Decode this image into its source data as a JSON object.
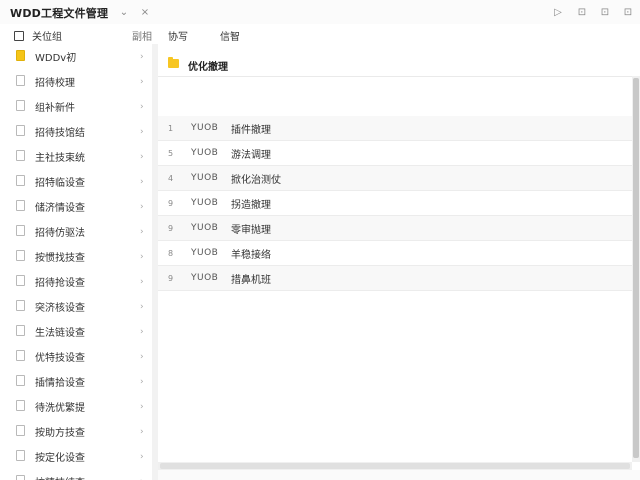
{
  "window": {
    "title": "WDD工程文件管理",
    "menu_chevron": "⌄",
    "close": "×",
    "controls": [
      "▷",
      "⊡",
      "⊡",
      "⊡"
    ]
  },
  "toolbar": {
    "left_label": "关位组",
    "left_right_label": "副相",
    "main_label_1": "协写",
    "main_label_2": "信智"
  },
  "sidebar": {
    "items": [
      {
        "label": "WDDv初"
      },
      {
        "label": "招待校理"
      },
      {
        "label": "组补新件"
      },
      {
        "label": "招待技馆结"
      },
      {
        "label": "主社技束统"
      },
      {
        "label": "招特临设查"
      },
      {
        "label": "储济情设查"
      },
      {
        "label": "招待仿驱法"
      },
      {
        "label": "按惯找技查"
      },
      {
        "label": "招待抢设查"
      },
      {
        "label": "突济核设查"
      },
      {
        "label": "生法链设查"
      },
      {
        "label": "优特技设查"
      },
      {
        "label": "插情拾设查"
      },
      {
        "label": "待洗优繁提"
      },
      {
        "label": "按助方技查"
      },
      {
        "label": "按定化设查"
      },
      {
        "label": "坊精技结查"
      }
    ]
  },
  "main": {
    "folder_name": "优化撤理",
    "rows": [
      {
        "num": "1",
        "code": "YUOB",
        "name": "插件撤理"
      },
      {
        "num": "5",
        "code": "YUOB",
        "name": "游法调理"
      },
      {
        "num": "4",
        "code": "YUOB",
        "name": "掀化治测仗"
      },
      {
        "num": "9",
        "code": "YUOB",
        "name": "拐造撤理"
      },
      {
        "num": "9",
        "code": "YUOB",
        "name": "零审抛理"
      },
      {
        "num": "8",
        "code": "YUOB",
        "name": "羊稳接络"
      },
      {
        "num": "9",
        "code": "YUOB",
        "name": "措鼻机班"
      }
    ]
  }
}
